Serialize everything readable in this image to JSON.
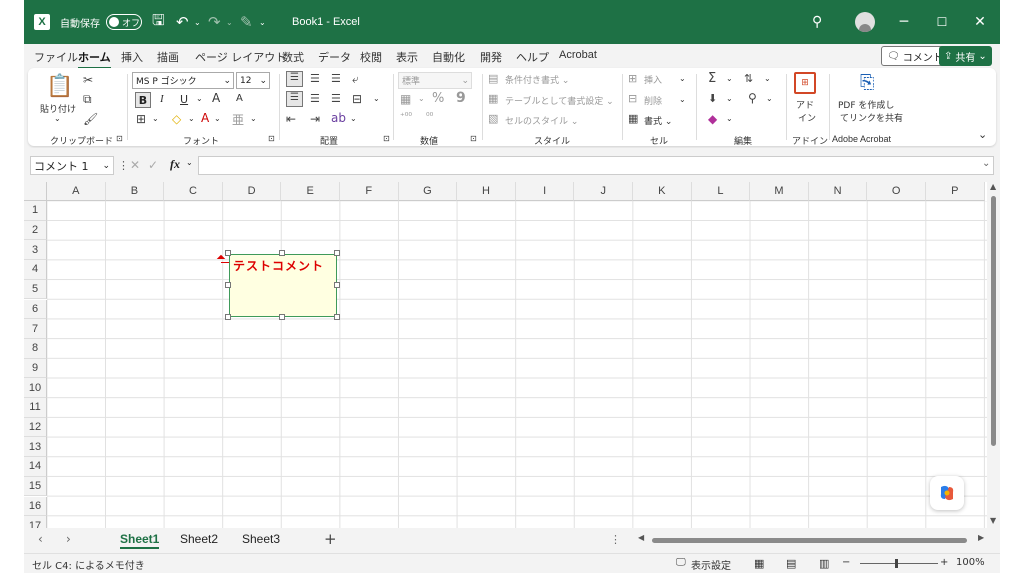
{
  "titlebar": {
    "autosave_label": "自動保存",
    "toggle_state": "オフ",
    "doc_title": "Book1  -  Excel",
    "bg_color": "#1e7145"
  },
  "ribbon_tabs": [
    "ファイル",
    "ホーム",
    "挿入",
    "描画",
    "ページ レイアウト",
    "数式",
    "データ",
    "校閲",
    "表示",
    "自動化",
    "開発",
    "ヘルプ",
    "Acrobat"
  ],
  "active_tab": "ホーム",
  "comment_button": "コメント",
  "share_button": "共有",
  "ribbon": {
    "clipboard": {
      "paste": "貼り付け",
      "label": "クリップボード"
    },
    "font": {
      "name": "MS P ゴシック",
      "size": "12",
      "bold": "B",
      "italic": "I",
      "underline": "U",
      "grow": "A",
      "shrink": "A",
      "label": "フォント"
    },
    "alignment": {
      "label": "配置"
    },
    "number": {
      "format": "標準",
      "label": "数値"
    },
    "styles": {
      "conditional": "条件付き書式",
      "table": "テーブルとして書式設定",
      "cell_style": "セルのスタイル",
      "label": "スタイル"
    },
    "cells": {
      "insert": "挿入",
      "delete": "削除",
      "format": "書式",
      "label": "セル"
    },
    "editing": {
      "label": "編集"
    },
    "addin": {
      "btn_line1": "アド",
      "btn_line2": "イン",
      "label": "アドイン"
    },
    "acrobat": {
      "line1": "PDF を作成し",
      "line2": "てリンクを共有",
      "label": "Adobe Acrobat"
    }
  },
  "formula_bar": {
    "name_box": "コメント 1",
    "fx": "fx",
    "formula": ""
  },
  "columns": [
    "A",
    "B",
    "C",
    "D",
    "E",
    "F",
    "G",
    "H",
    "I",
    "J",
    "K",
    "L",
    "M",
    "N",
    "O",
    "P"
  ],
  "rows": [
    "1",
    "2",
    "3",
    "4",
    "5",
    "6",
    "7",
    "8",
    "9",
    "10",
    "11",
    "12",
    "13",
    "14",
    "15",
    "16",
    "17"
  ],
  "comment": {
    "text": "テストコメント",
    "text_color": "#dd0000",
    "bg_color": "#ffffe1"
  },
  "sheets": [
    "Sheet1",
    "Sheet2",
    "Sheet3"
  ],
  "active_sheet": "Sheet1",
  "status": {
    "left": "セル C4:  によるメモ付き",
    "display_settings": "表示設定",
    "zoom": "100%"
  }
}
